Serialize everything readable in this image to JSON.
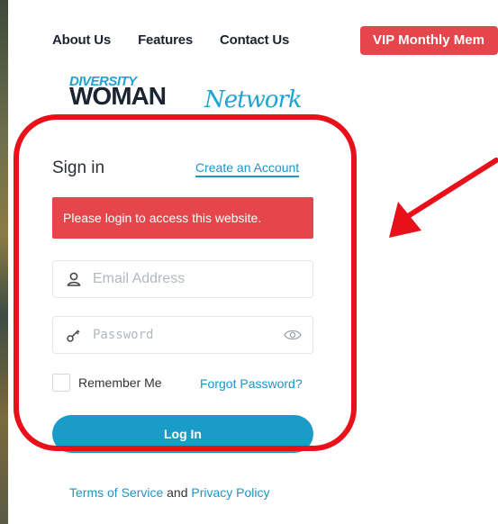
{
  "nav": {
    "items": [
      "About Us",
      "Features",
      "Contact Us"
    ],
    "vip_label": "VIP Monthly Mem"
  },
  "logo": {
    "line1": "DIVERSITY",
    "line2": "WOMAN",
    "line3": "Network"
  },
  "signin": {
    "title": "Sign in",
    "create_account": "Create an Account",
    "alert": "Please login to access this website.",
    "email_placeholder": "Email Address",
    "password_placeholder": "Password",
    "remember_label": "Remember Me",
    "forgot_label": "Forgot Password?",
    "login_label": "Log In"
  },
  "footer": {
    "terms": "Terms of Service",
    "and": "and",
    "privacy": "Privacy Policy"
  },
  "colors": {
    "accent": "#1a9cc9",
    "alert": "#e5464c",
    "highlight": "#e8111a",
    "text_dark": "#1b2431"
  },
  "icons": [
    "user-icon",
    "key-icon",
    "eye-icon",
    "arrow-annotation-icon"
  ]
}
